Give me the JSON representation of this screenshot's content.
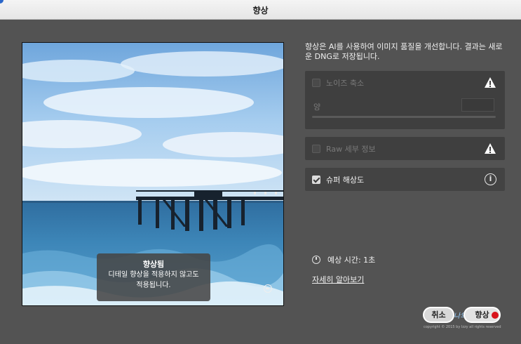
{
  "window": {
    "title": "향상"
  },
  "preview": {
    "overlay_title": "향상됨",
    "overlay_line1": "디테일 향상을 적용하지 않고도",
    "overlay_line2": "적용됩니다."
  },
  "description": "향상은 AI를 사용하여 이미지 품질을 개선합니다. 결과는 새로운 DNG로 저장됩니다.",
  "options": {
    "noise": {
      "label": "노이즈 축소",
      "checked": false,
      "enabled": false,
      "amount_label": "양",
      "amount_value": ""
    },
    "raw": {
      "label": "Raw 세부 정보",
      "checked": false,
      "enabled": false
    },
    "super": {
      "label": "슈퍼 해상도",
      "checked": true,
      "enabled": true
    }
  },
  "estimate": {
    "label": "예상 시간: 1초"
  },
  "learn_more": "자세히 알아보기",
  "buttons": {
    "cancel": "취소",
    "enhance": "향상"
  },
  "watermark": {
    "script_text": "나의",
    "copyright": "copyright © 2015 by Izzy all rights reserved"
  },
  "colors": {
    "background": "#535353",
    "panel": "#3f3f3f",
    "titlebar": "#ececec",
    "warn": "#ffffff"
  }
}
